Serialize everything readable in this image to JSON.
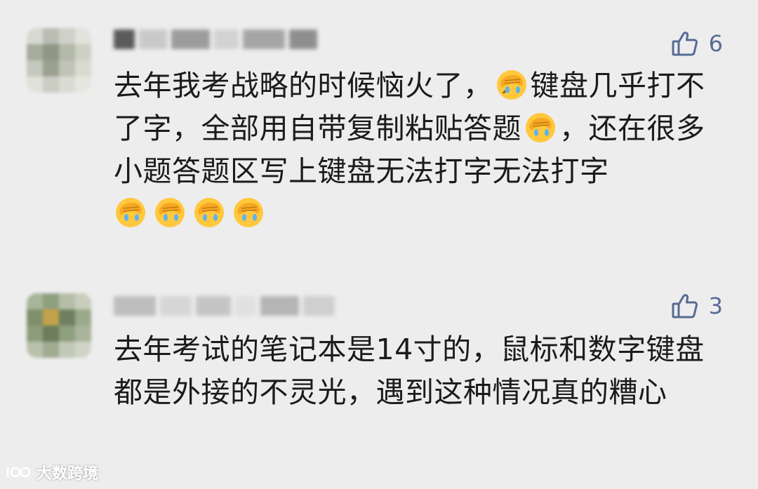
{
  "comments": [
    {
      "likes": "6",
      "text_part1": "去年我考战略的时候恼火了，",
      "text_part2": "键盘几乎打不了字，全部用自带复制粘贴答题",
      "text_part3": "，还在很多小题答题区写上键盘无法打字无法打字",
      "emoji_name": "facepalm-crying-emoji"
    },
    {
      "likes": "3",
      "text": "去年考试的笔记本是14寸的，鼠标和数字键盘都是外接的不灵光，遇到这种情况真的糟心"
    }
  ],
  "watermark": {
    "text": "大数跨境"
  },
  "colors": {
    "background": "#ededed",
    "like": "#576b95",
    "text": "#1b1b1b"
  },
  "icons": [
    "thumbs-up-icon",
    "facepalm-crying-emoji",
    "watermark-logo-icon"
  ]
}
